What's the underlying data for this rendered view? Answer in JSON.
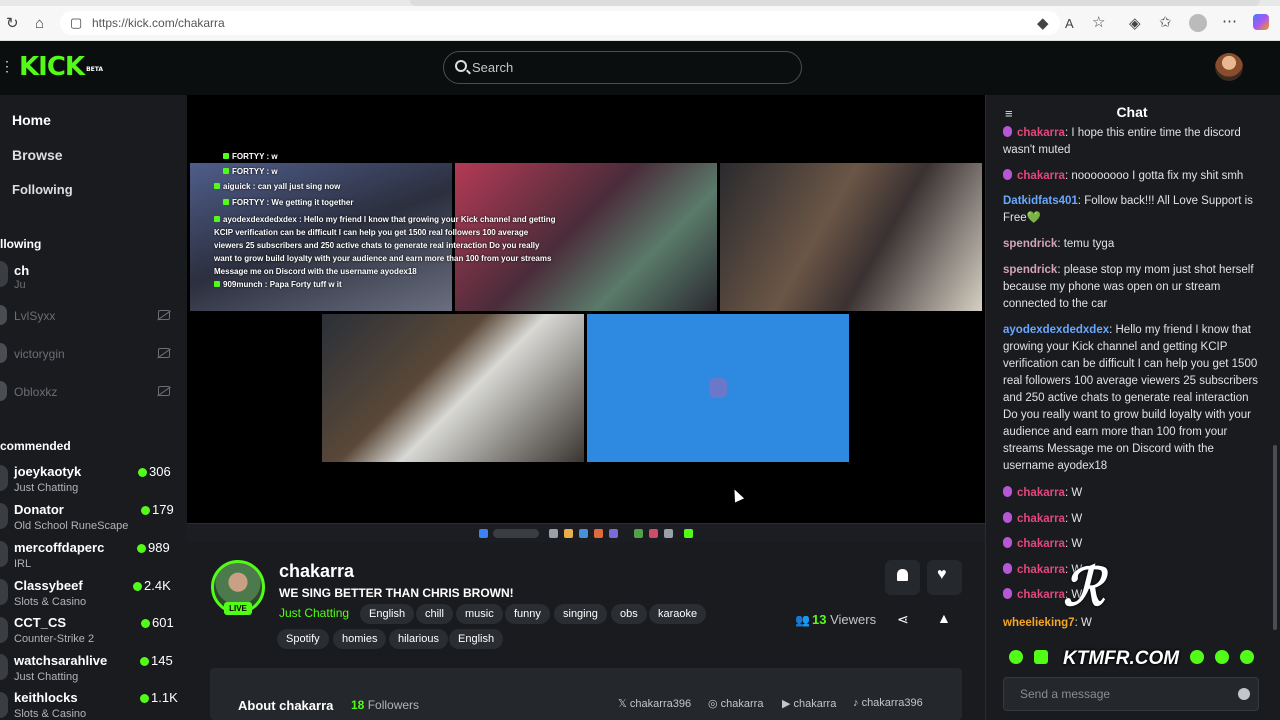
{
  "browser": {
    "url": "https://kick.com/chakarra",
    "icons": [
      "refresh-icon",
      "home-icon",
      "site-info-icon",
      "shield-icon",
      "read-aloud-icon",
      "favorite-icon",
      "extensions-icon",
      "collections-icon",
      "profile-icon",
      "more-icon",
      "copilot-icon"
    ]
  },
  "header": {
    "logo": "KICK",
    "logo_badge": "BETA",
    "search_placeholder": "Search"
  },
  "sidebar": {
    "home": "Home",
    "browse": "Browse",
    "following": "Following",
    "following_clip": "llowing",
    "following_first_clip": "ch",
    "following_first_sub": "Ju",
    "offline_channels": [
      "LvlSyxx",
      "victorygin",
      "Obloxkz"
    ],
    "recommended_label": "commended",
    "recommended": [
      {
        "name": "joeykaotyk",
        "category": "Just Chatting",
        "viewers": "306"
      },
      {
        "name": "Donator",
        "category": "Old School RuneScape",
        "viewers": "179"
      },
      {
        "name": "mercoffdaperc",
        "category": "IRL",
        "viewers": "989"
      },
      {
        "name": "Classybeef",
        "category": "Slots & Casino",
        "viewers": "2.4K"
      },
      {
        "name": "CCT_CS",
        "category": "Counter-Strike 2",
        "viewers": "601"
      },
      {
        "name": "watchsarahlive",
        "category": "Just Chatting",
        "viewers": "145"
      },
      {
        "name": "keithlocks",
        "category": "Slots & Casino",
        "viewers": "1.1K"
      }
    ]
  },
  "overlay_chat": [
    {
      "user": "FORTYY",
      "text": "w"
    },
    {
      "user": "FORTYY",
      "text": "w"
    },
    {
      "user": "aiguick",
      "text": "can yall just sing now"
    },
    {
      "user": "FORTYY",
      "text": "We getting it together"
    },
    {
      "user": "ayodexdexdedxdex",
      "text": "Hello my friend I know that growing your Kick channel and getting KCIP verification can be difficult I can help you get 1500 real followers 100 average viewers 25 subscribers and 250 active chats to generate real interaction Do you really want to grow build loyalty with your audience and earn more than 100 from your streams Message me on Discord with the username ayodex18"
    },
    {
      "user": "909munch",
      "text": "Papa Forty tuff w it"
    }
  ],
  "stream": {
    "channel": "chakarra",
    "live": "LIVE",
    "title": "WE SING BETTER THAN CHRIS BROWN!",
    "category": "Just Chatting",
    "tags_row1": [
      "English",
      "chill",
      "music",
      "funny",
      "singing",
      "obs",
      "karaoke"
    ],
    "tags_row2": [
      "Spotify",
      "homies",
      "hilarious",
      "English"
    ],
    "viewers_count": "13",
    "viewers_label": "Viewers"
  },
  "about": {
    "label": "About chakarra",
    "followers_count": "18",
    "followers_label": "Followers",
    "socials": [
      {
        "icon": "x-icon",
        "handle": "chakarra396"
      },
      {
        "icon": "instagram-icon",
        "handle": "chakarra"
      },
      {
        "icon": "youtube-icon",
        "handle": "chakarra"
      },
      {
        "icon": "tiktok-icon",
        "handle": "chakarra396"
      }
    ]
  },
  "chat": {
    "title": "Chat",
    "input_placeholder": "Send a message",
    "messages": [
      {
        "user": "chakarra",
        "color": "pink",
        "badge": true,
        "text": "I hope this entire time the discord wasn't muted"
      },
      {
        "user": "chakarra",
        "color": "pink",
        "badge": true,
        "text": "noooooooo I gotta fix my shit smh"
      },
      {
        "user": "Datkidfats401",
        "color": "blue",
        "badge": false,
        "text": "Follow back!!! All Love Support is Free💚"
      },
      {
        "user": "spendrick",
        "color": "mauve",
        "badge": false,
        "text": "temu tyga"
      },
      {
        "user": "spendrick",
        "color": "mauve",
        "badge": false,
        "text": "please stop my mom just shot herself because my phone was open on ur stream connected to the car"
      },
      {
        "user": "ayodexdexdedxdex",
        "color": "blue",
        "badge": false,
        "text": "Hello my friend I know that growing your Kick channel and getting KCIP verification can be difficult I can help you get 1500 real followers 100 average viewers 25 subscribers and 250 active chats to generate real interaction Do you really want to grow build loyalty with your audience and earn more than 100 from your streams Message me on Discord with the username ayodex18"
      },
      {
        "user": "chakarra",
        "color": "pink",
        "badge": true,
        "text": "W"
      },
      {
        "user": "chakarra",
        "color": "pink",
        "badge": true,
        "text": "W"
      },
      {
        "user": "chakarra",
        "color": "pink",
        "badge": true,
        "text": "W"
      },
      {
        "user": "chakarra",
        "color": "pink",
        "badge": true,
        "text": "W"
      },
      {
        "user": "chakarra",
        "color": "pink",
        "badge": true,
        "text": "W"
      },
      {
        "user": "wheelieking7",
        "color": "orange",
        "badge": false,
        "text": "W"
      }
    ]
  },
  "watermark": {
    "text": "KTMFR.COM"
  },
  "colors": {
    "accent": "#53fc18",
    "background": "#191b1f",
    "header": "#0b0e0f",
    "chat_pink": "#e5477b",
    "chat_blue": "#6aa7ff",
    "tile_blue": "#2d8ae0"
  }
}
